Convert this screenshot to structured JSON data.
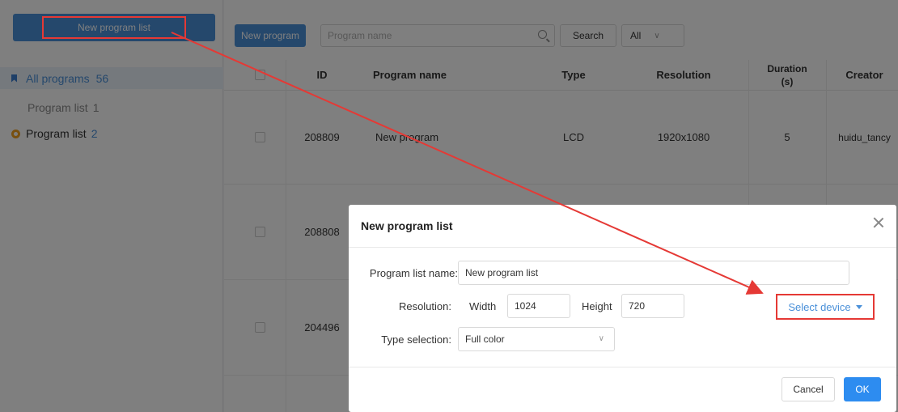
{
  "sidebar": {
    "new_list_button": "New program list",
    "all_programs_label": "All programs",
    "all_programs_count": "56",
    "program_lists": [
      {
        "label": "Program list",
        "count": "1"
      },
      {
        "label": "Program list",
        "count": "2"
      }
    ]
  },
  "toolbar": {
    "new_program_button": "New program",
    "search_placeholder": "Program name",
    "search_button": "Search",
    "type_filter_value": "All"
  },
  "table": {
    "columns": [
      "ID",
      "Program name",
      "Type",
      "Resolution",
      "Duration (s)",
      "Creator"
    ],
    "duration_header_line1": "Duration",
    "duration_header_line2": "(s)",
    "rows": [
      {
        "id": "208809",
        "name": "New program",
        "type": "LCD",
        "resolution": "1920x1080",
        "duration": "5",
        "creator": "huidu_tancy"
      },
      {
        "id": "208808"
      },
      {
        "id": "204496"
      }
    ]
  },
  "dialog": {
    "title": "New program list",
    "list_name_label": "Program list name:",
    "list_name_value": "New program list",
    "resolution_label": "Resolution:",
    "width_label": "Width",
    "width_value": "1024",
    "height_label": "Height",
    "height_value": "720",
    "type_label": "Type selection:",
    "type_value": "Full color",
    "select_device": "Select device",
    "cancel": "Cancel",
    "ok": "OK"
  },
  "colors": {
    "primary": "#4a90d9",
    "ok_button": "#2d8cf0",
    "annotation": "#e53935",
    "list_ring": "#f0a020"
  }
}
